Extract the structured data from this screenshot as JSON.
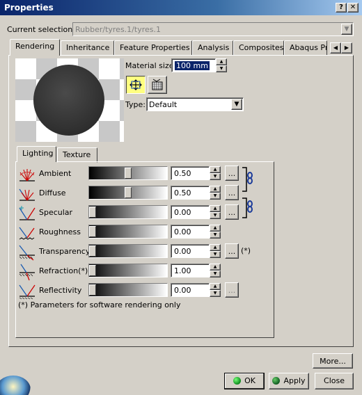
{
  "window": {
    "title": "Properties",
    "help_btn": "?",
    "close_btn": "✕"
  },
  "selection": {
    "label": "Current selection :",
    "value": "Rubber/tyres.1/tyres.1"
  },
  "tabs": [
    {
      "label": "Rendering",
      "active": true
    },
    {
      "label": "Inheritance"
    },
    {
      "label": "Feature Properties"
    },
    {
      "label": "Analysis"
    },
    {
      "label": "Composites"
    },
    {
      "label": "Abaqus Pr"
    }
  ],
  "material": {
    "size_label": "Material size:",
    "size_value": "100 mm",
    "type_label": "Type:",
    "type_value": "Default"
  },
  "subtabs": [
    {
      "label": "Lighting",
      "active": true
    },
    {
      "label": "Texture"
    }
  ],
  "rows": [
    {
      "label": "Ambient",
      "value": "0.50",
      "level": 0.5,
      "icon": "ambient-icon"
    },
    {
      "label": "Diffuse",
      "value": "0.50",
      "level": 0.5,
      "icon": "diffuse-icon"
    },
    {
      "label": "Specular",
      "value": "0.00",
      "level": 0.0,
      "icon": "specular-icon"
    },
    {
      "label": "Roughness",
      "value": "0.00",
      "level": 0.0,
      "icon": "roughness-icon"
    },
    {
      "label": "Transparency",
      "value": "0.00",
      "level": 0.0,
      "icon": "transparency-icon"
    },
    {
      "label": "Refraction(*)",
      "value": "1.00",
      "level": 0.0,
      "icon": "refraction-icon"
    },
    {
      "label": "Reflectivity",
      "value": "0.00",
      "level": 0.0,
      "icon": "reflectivity-icon"
    }
  ],
  "ellipsis": "...",
  "transparency_note": "(*)",
  "footnote": "(*) Parameters for software rendering only",
  "buttons": {
    "more": "More...",
    "ok": "OK",
    "apply": "Apply",
    "close": "Close"
  },
  "colors": {
    "title_start": "#0a246a",
    "title_end": "#a6caf0",
    "ok_ball": "#1a9a2a",
    "apply_ball": "#1a6a2a",
    "select_highlight": "#0a246a"
  }
}
